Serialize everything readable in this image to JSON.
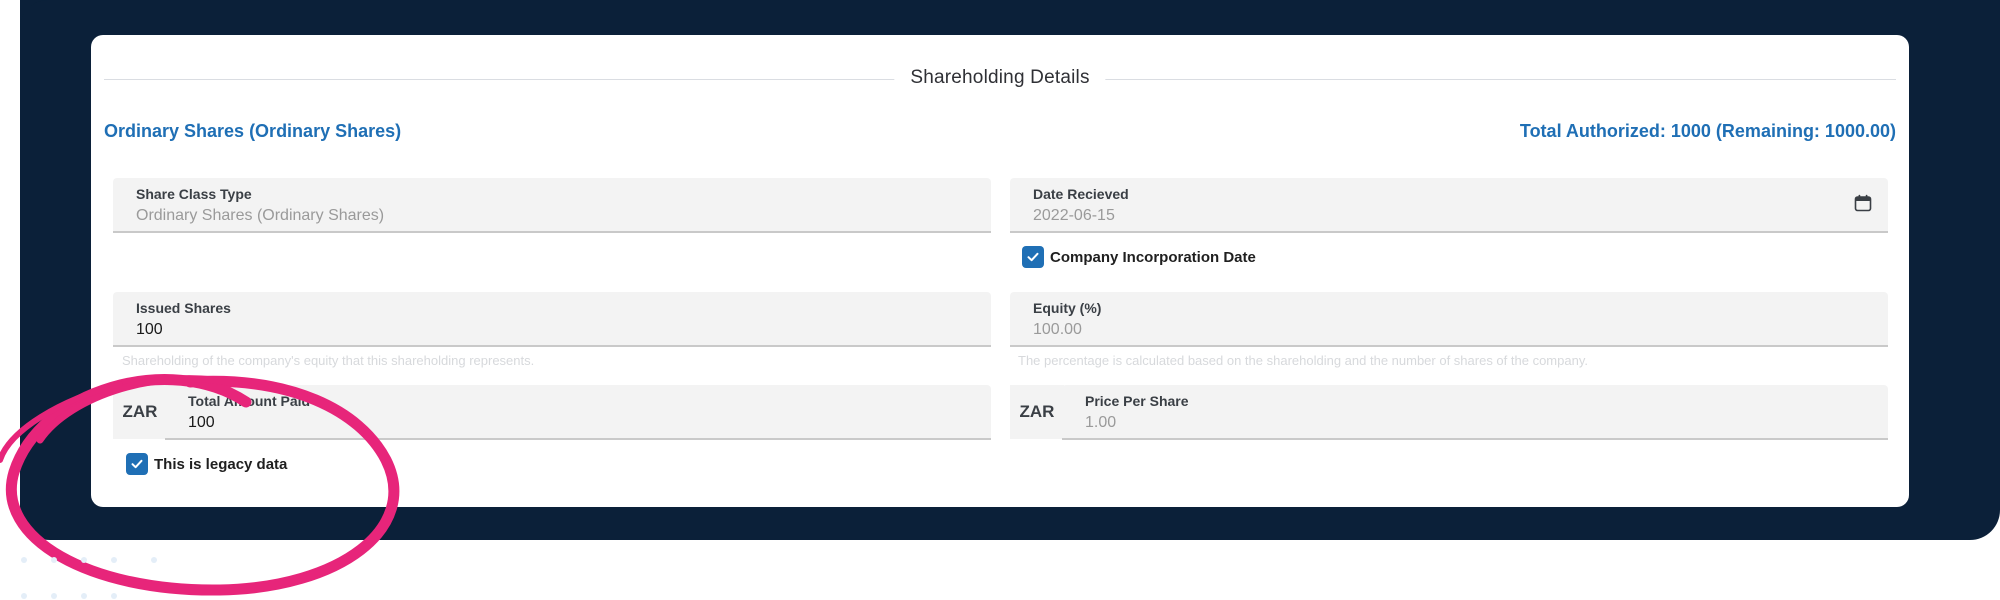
{
  "section": {
    "title": "Shareholding Details"
  },
  "share_class": {
    "title": "Ordinary Shares (Ordinary Shares)",
    "total_authorized": "Total Authorized: 1000 (Remaining: 1000.00)"
  },
  "fields": {
    "share_class_type": {
      "label": "Share Class Type",
      "value": "Ordinary Shares (Ordinary Shares)"
    },
    "date_received": {
      "label": "Date Recieved",
      "value": "2022-06-15",
      "icon": "calendar-icon"
    },
    "issued_shares": {
      "label": "Issued Shares",
      "value": "100",
      "hint": "Shareholding of the company's equity that this shareholding represents."
    },
    "equity": {
      "label": "Equity (%)",
      "value": "100.00",
      "hint": "The percentage is calculated based on the shareholding and the number of shares of the company."
    },
    "total_amount_paid": {
      "prefix": "ZAR",
      "label": "Total Amount Paid",
      "value": "100"
    },
    "price_per_share": {
      "prefix": "ZAR",
      "label": "Price Per Share",
      "value": "1.00"
    }
  },
  "checkboxes": {
    "incorporation_date": {
      "label": "Company Incorporation Date",
      "checked": true
    },
    "legacy_data": {
      "label": "This is legacy data",
      "checked": true
    }
  },
  "colors": {
    "frame": "#0b2039",
    "accent": "#1f6fb5",
    "highlight": "#e7257a"
  }
}
